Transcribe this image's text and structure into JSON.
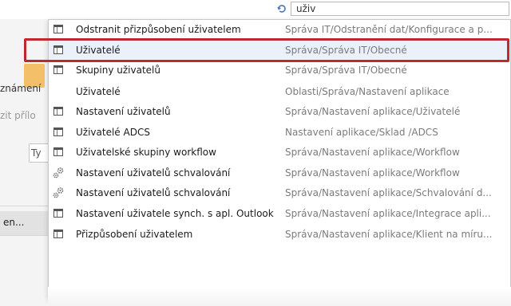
{
  "search": {
    "value": "uživ"
  },
  "background": {
    "left_label_1": "známení",
    "left_label_2": "zit přílo",
    "field_label": "Ty",
    "bar_label": "en..."
  },
  "results": [
    {
      "name": "Odstranit přizpůsobení uživatelem",
      "path": "Správa IT/Odstranění dat/Konfigurace a p...",
      "icon": "table-icon"
    },
    {
      "name": "Uživatelé",
      "path": "Správa/Správa IT/Obecné",
      "icon": "table-icon"
    },
    {
      "name": "Skupiny uživatelů",
      "path": "Správa/Správa IT/Obecné",
      "icon": "table-icon"
    },
    {
      "name": "Uživatelé",
      "path": "Oblasti/Správa/Nastavení aplikace",
      "icon": "none"
    },
    {
      "name": "Nastavení uživatelů",
      "path": "Správa/Nastavení aplikace/Uživatelé",
      "icon": "table-icon"
    },
    {
      "name": "Uživatelé ADCS",
      "path": "Nastavení aplikace/Sklad /ADCS",
      "icon": "table-icon"
    },
    {
      "name": "Uživatelské skupiny workflow",
      "path": "Správa/Nastavení aplikace/Workflow",
      "icon": "table-icon"
    },
    {
      "name": "Nastavení uživatelů schvalování",
      "path": "Správa/Nastavení aplikace/Workflow",
      "icon": "gears-icon"
    },
    {
      "name": "Nastavení uživatelů schvalování",
      "path": "Správa/Nastavení aplikace/Schvalování d...",
      "icon": "gears-icon"
    },
    {
      "name": "Nastavení uživatele synch. s apl. Outlook",
      "path": "Správa/Nastavení aplikace/Integrace apli...",
      "icon": "table-icon"
    },
    {
      "name": "Přizpůsobení uživatelem",
      "path": "Správa/Nastavení aplikace/Klient na míru...",
      "icon": "table-icon"
    }
  ],
  "colors": {
    "highlight": "#c0282f",
    "selected_row": "#eaf1fb",
    "path_text": "#7b7b7b"
  }
}
